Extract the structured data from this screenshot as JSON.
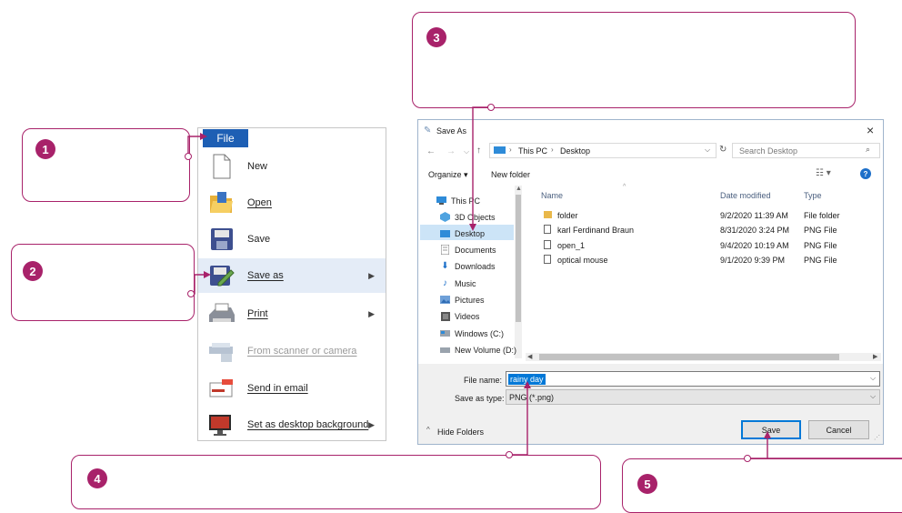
{
  "callouts": [
    {
      "number": "1"
    },
    {
      "number": "2"
    },
    {
      "number": "3"
    },
    {
      "number": "4"
    },
    {
      "number": "5"
    }
  ],
  "file_menu": {
    "tab_label": "File",
    "items": [
      {
        "label": "New",
        "icon": "new-document-icon",
        "submenu": false,
        "enabled": true
      },
      {
        "label": "Open",
        "icon": "open-folder-icon",
        "submenu": false,
        "enabled": true
      },
      {
        "label": "Save",
        "icon": "floppy-disk-icon",
        "submenu": false,
        "enabled": true
      },
      {
        "label": "Save as",
        "icon": "save-as-icon",
        "submenu": true,
        "enabled": true,
        "selected": true
      },
      {
        "label": "Print",
        "icon": "printer-icon",
        "submenu": true,
        "enabled": true
      },
      {
        "label": "From scanner or camera",
        "icon": "scanner-icon",
        "submenu": false,
        "enabled": false
      },
      {
        "label": "Send in email",
        "icon": "email-icon",
        "submenu": false,
        "enabled": true
      },
      {
        "label": "Set as desktop background",
        "icon": "desktop-background-icon",
        "submenu": true,
        "enabled": true
      }
    ]
  },
  "dialog": {
    "title": "Save As",
    "close_glyph": "×",
    "breadcrumb": [
      "This PC",
      "Desktop"
    ],
    "search_placeholder": "Search Desktop",
    "toolbar": {
      "organize": "Organize ▾",
      "new_folder": "New folder"
    },
    "nav": [
      {
        "label": "This PC",
        "icon": "computer-icon"
      },
      {
        "label": "3D Objects",
        "icon": "3d-objects-icon"
      },
      {
        "label": "Desktop",
        "icon": "desktop-icon",
        "selected": true
      },
      {
        "label": "Documents",
        "icon": "documents-icon"
      },
      {
        "label": "Downloads",
        "icon": "downloads-icon"
      },
      {
        "label": "Music",
        "icon": "music-icon"
      },
      {
        "label": "Pictures",
        "icon": "pictures-icon"
      },
      {
        "label": "Videos",
        "icon": "videos-icon"
      },
      {
        "label": "Windows (C:)",
        "icon": "drive-icon"
      },
      {
        "label": "New Volume (D:)",
        "icon": "drive-icon"
      }
    ],
    "columns": {
      "name": "Name",
      "date": "Date modified",
      "type": "Type"
    },
    "files": [
      {
        "name": "folder",
        "date": "9/2/2020 11:39 AM",
        "type": "File folder",
        "icon": "folder-icon"
      },
      {
        "name": "karl Ferdinand Braun",
        "date": "8/31/2020 3:24 PM",
        "type": "PNG File",
        "icon": "png-file-icon"
      },
      {
        "name": "open_1",
        "date": "9/4/2020 10:19 AM",
        "type": "PNG File",
        "icon": "png-file-icon"
      },
      {
        "name": "optical mouse",
        "date": "9/1/2020 9:39 PM",
        "type": "PNG File",
        "icon": "png-file-icon"
      }
    ],
    "file_name_label": "File name:",
    "file_name_value": "rainy day",
    "save_type_label": "Save as type:",
    "save_type_value": "PNG (*.png)",
    "hide_folders": "Hide Folders",
    "save_button": "Save",
    "cancel_button": "Cancel"
  },
  "colors": {
    "accent": "#a8226a",
    "menu_tab": "#1e5fb4",
    "selection": "#cce4f7"
  }
}
